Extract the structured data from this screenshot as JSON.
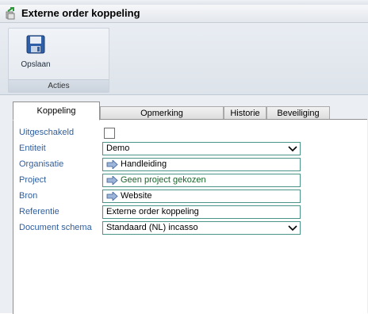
{
  "window": {
    "title": "Externe order koppeling"
  },
  "ribbon": {
    "save_label": "Opslaan",
    "group_label": "Acties"
  },
  "tabs": [
    {
      "label": "Koppeling"
    },
    {
      "label": "Opmerking"
    },
    {
      "label": "Historie"
    },
    {
      "label": "Beveiliging"
    }
  ],
  "form": {
    "disabled": {
      "label": "Uitgeschakeld",
      "checked": false
    },
    "entity": {
      "label": "Entiteit",
      "value": "Demo"
    },
    "organization": {
      "label": "Organisatie",
      "value": "Handleiding"
    },
    "project": {
      "label": "Project",
      "value": "Geen project gekozen"
    },
    "source": {
      "label": "Bron",
      "value": "Website"
    },
    "reference": {
      "label": "Referentie",
      "value": "Externe order koppeling"
    },
    "document_schema": {
      "label": "Document schema",
      "value": "Standaard (NL) incasso"
    }
  }
}
